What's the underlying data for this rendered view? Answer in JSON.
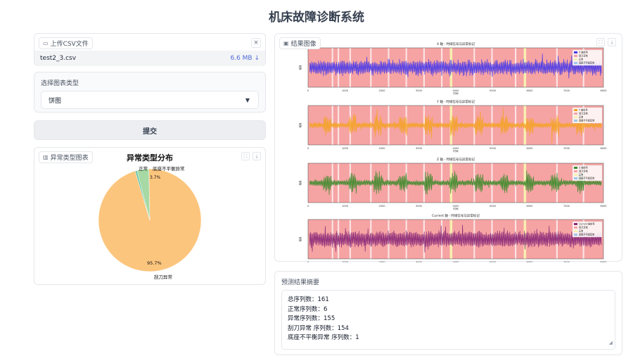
{
  "title": "机床故障诊断系统",
  "upload": {
    "label": "上传CSV文件",
    "file_name": "test2_3.csv",
    "file_size": "6.6 MB ↓",
    "close": "×"
  },
  "chart_select": {
    "label": "选择图表类型",
    "value": "饼图"
  },
  "submit_label": "提交",
  "pie_panel": {
    "label": "异常类型图表",
    "chart_data": {
      "type": "pie",
      "title": "异常类型分布",
      "slices": [
        {
          "label": "刮刀异常",
          "value": 95.7,
          "pct_label": "95.7%",
          "color": "#fcc57d"
        },
        {
          "label": "底座不平衡异常",
          "value": 0.6,
          "pct_label": "",
          "color": "#66c2a5"
        },
        {
          "label": "正常",
          "value": 3.7,
          "pct_label": "3.7%",
          "color": "#a6d9a4"
        }
      ]
    }
  },
  "results_panel": {
    "label": "结果图像",
    "plots": [
      {
        "title": "X 轴 - 时域信号与异常标记",
        "color": "#4b3be8",
        "legend": [
          "X 轴信号",
          "刮刀异常",
          "正常",
          "底座不平衡异常"
        ]
      },
      {
        "title": "Y 轴 - 时域信号与异常标记",
        "color": "#f4a324",
        "legend": [
          "Y 轴信号",
          "刮刀异常",
          "正常",
          "底座不平衡异常"
        ]
      },
      {
        "title": "Z 轴 - 时域信号与异常标记",
        "color": "#3d8b2c",
        "legend": [
          "Z 轴信号",
          "刮刀异常",
          "正常",
          "底座不平衡异常"
        ]
      },
      {
        "title": "Current 轴 - 时域信号与异常标记",
        "color": "#8a2a78",
        "legend": [
          "Current 轴信号",
          "刮刀异常",
          "正常",
          "底座不平衡异常"
        ]
      }
    ],
    "x_ticks": [
      "0",
      "1000",
      "2000",
      "3000",
      "4000",
      "5000",
      "6000",
      "7000",
      "8000"
    ],
    "xlabel": "时间",
    "ylabel": "幅值"
  },
  "summary": {
    "label": "预测结果摘要",
    "lines": [
      "总序列数：161",
      "正常序列数：6",
      "异常序列数：155",
      "刮刀异常 序列数：154",
      "底座不平衡异常 序列数：1"
    ]
  }
}
